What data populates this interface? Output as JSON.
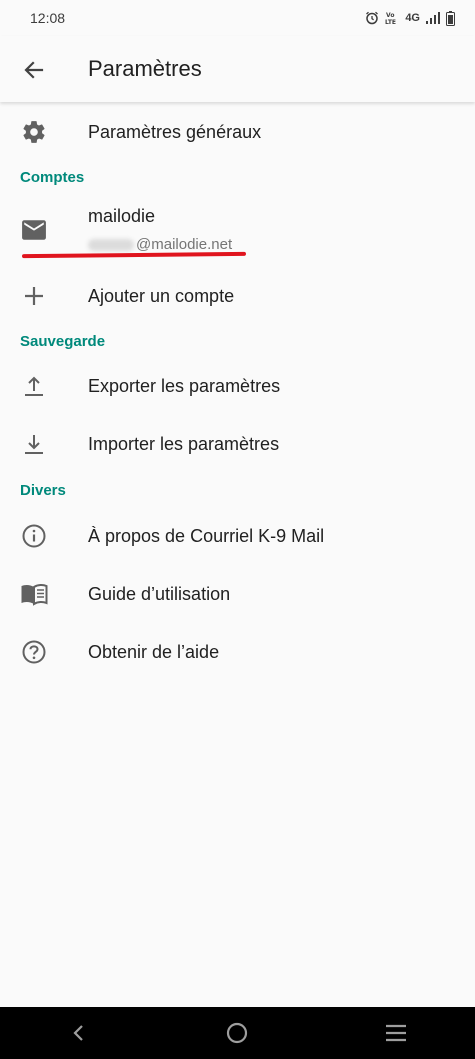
{
  "status_bar": {
    "time": "12:08",
    "network": "4G",
    "icons": [
      "alarm-icon",
      "volte-icon",
      "signal-icon",
      "battery-icon"
    ]
  },
  "toolbar": {
    "title": "Paramètres",
    "back_icon": "arrow-back-icon"
  },
  "general": {
    "label": "Paramètres généraux",
    "icon": "gear-icon"
  },
  "sections": {
    "accounts": "Comptes",
    "backup": "Sauvegarde",
    "misc": "Divers"
  },
  "account": {
    "name": "mailodie",
    "email_suffix": "@mailodie.net",
    "icon": "mail-icon"
  },
  "add_account": {
    "label": "Ajouter un compte",
    "icon": "plus-icon"
  },
  "export": {
    "label": "Exporter les paramètres",
    "icon": "upload-icon"
  },
  "import": {
    "label": "Importer les paramètres",
    "icon": "download-icon"
  },
  "about": {
    "label": "À propos de Courriel K-9 Mail",
    "icon": "info-icon"
  },
  "guide": {
    "label": "Guide d’utilisation",
    "icon": "book-icon"
  },
  "help": {
    "label": "Obtenir de l’aide",
    "icon": "help-icon"
  },
  "colors": {
    "accent": "#00897b",
    "highlight": "#e0141e",
    "background": "#fafafa",
    "nav_bar": "#000000"
  }
}
